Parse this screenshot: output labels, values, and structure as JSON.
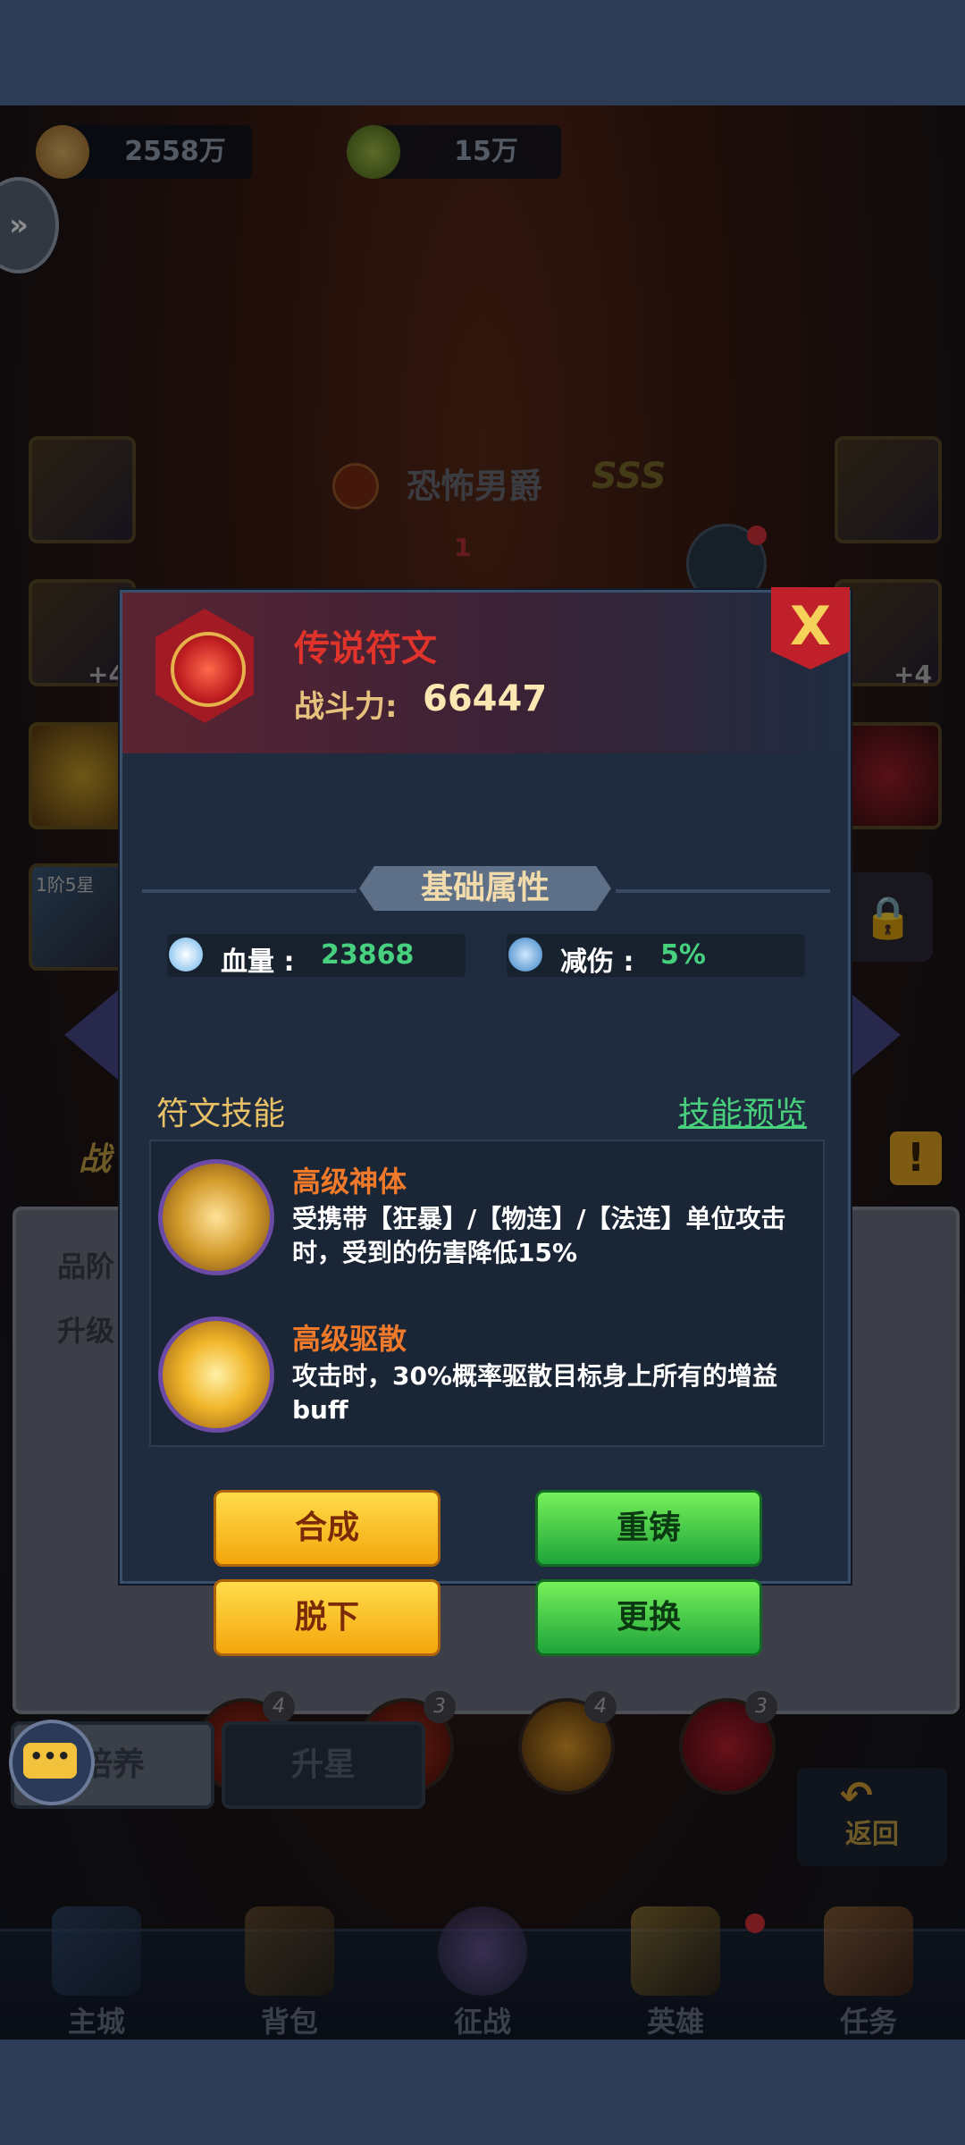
{
  "currency": {
    "gold": "2558万",
    "stone": "15万"
  },
  "hero": {
    "name": "恐怖男爵",
    "grade": "SSS",
    "level_badge": "1",
    "star_label": "1阶5星",
    "plus_left": "+4",
    "plus_right": "+4"
  },
  "lower_panel": {
    "quality_label": "品阶",
    "upgrade_label": "升级",
    "gems": [
      {
        "count": "4"
      },
      {
        "count": "3"
      },
      {
        "count": "4"
      },
      {
        "count": "3"
      }
    ],
    "tabs": {
      "cultivate": "培养",
      "star_up": "升星"
    },
    "back_label": "返回",
    "side_tab_fragment": "战"
  },
  "bottom_nav": {
    "items": [
      {
        "label": "主城",
        "icon": "castle-icon"
      },
      {
        "label": "背包",
        "icon": "chest-icon"
      },
      {
        "label": "征战",
        "icon": "dragon-icon"
      },
      {
        "label": "英雄",
        "icon": "helmet-icon"
      },
      {
        "label": "任务",
        "icon": "scroll-icon"
      }
    ]
  },
  "modal": {
    "title": "传说符文",
    "power_label": "战斗力:",
    "power_value": "66447",
    "close_label": "X",
    "section_title": "基础属性",
    "attributes": [
      {
        "label": "血量 :",
        "value": "23868",
        "icon": "heart-gem-icon"
      },
      {
        "label": "减伤 :",
        "value": "5%",
        "icon": "shield-gem-icon"
      }
    ],
    "skills_title": "符文技能",
    "skills_preview": "技能预览",
    "skills": [
      {
        "name": "高级神体",
        "desc": "受携带【狂暴】/【物连】/【法连】单位攻击时，受到的伤害降低15%",
        "icon": "divine-body-icon"
      },
      {
        "name": "高级驱散",
        "desc": "攻击时，30%概率驱散目标身上所有的增益buff",
        "icon": "dispel-icon"
      }
    ],
    "buttons": {
      "compose": "合成",
      "recast": "重铸",
      "unequip": "脱下",
      "replace": "更换"
    }
  },
  "colors": {
    "rune_red": "#e0332b",
    "attr_green": "#47d17e",
    "skill_orange": "#f07a2a",
    "gold_text": "#e8c066"
  }
}
